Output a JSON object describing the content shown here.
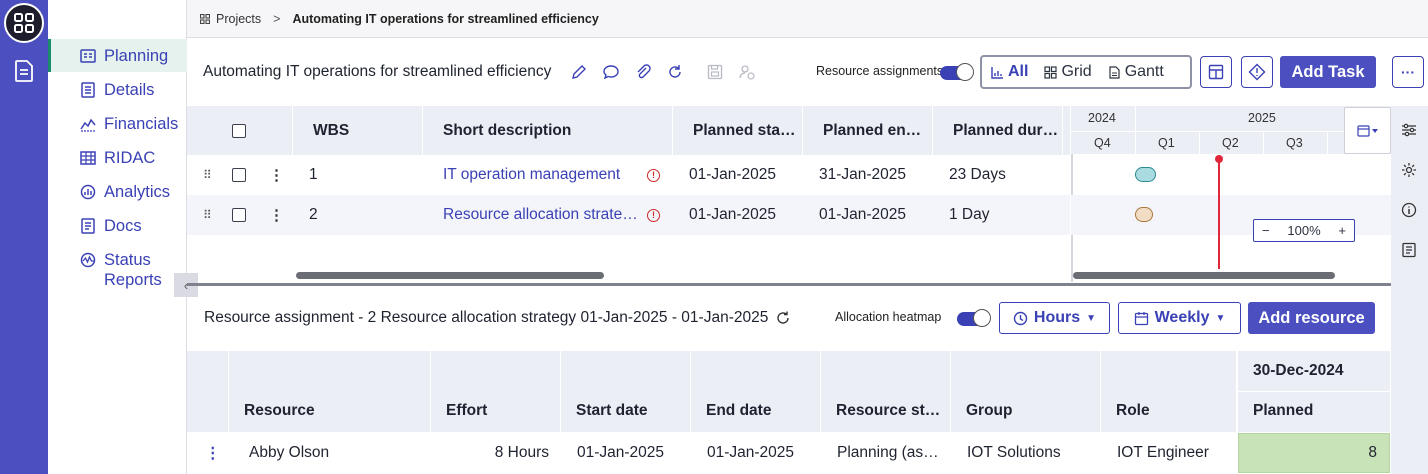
{
  "breadcrumb": {
    "root": "Projects",
    "separator": ">",
    "current": "Automating IT operations for streamlined efficiency"
  },
  "sidenav": {
    "items": [
      {
        "label": "Planning",
        "icon": "planning-icon"
      },
      {
        "label": "Details",
        "icon": "details-icon"
      },
      {
        "label": "Financials",
        "icon": "financials-icon"
      },
      {
        "label": "RIDAC",
        "icon": "ridac-icon"
      },
      {
        "label": "Analytics",
        "icon": "analytics-icon"
      },
      {
        "label": "Docs",
        "icon": "docs-icon"
      },
      {
        "label": "Status Reports",
        "label_line1": "Status",
        "label_line2": "Reports",
        "icon": "status-reports-icon"
      }
    ],
    "active": "Planning"
  },
  "toolbar": {
    "title": "Automating IT operations for streamlined efficiency",
    "resource_toggle_label": "Resource assignments",
    "resource_toggle_on": true,
    "views": [
      {
        "label": "All",
        "icon": "chart-icon",
        "active": true
      },
      {
        "label": "Grid",
        "icon": "grid-icon",
        "active": false
      },
      {
        "label": "Gantt",
        "icon": "document-icon",
        "active": false
      }
    ],
    "add_task_label": "Add Task",
    "more_label": "···"
  },
  "task_table": {
    "columns": [
      "WBS",
      "Short description",
      "Planned sta…",
      "Planned en…",
      "Planned dur…"
    ],
    "rows": [
      {
        "wbs": "1",
        "description": "IT operation management",
        "start": "01-Jan-2025",
        "end": "31-Jan-2025",
        "duration": "23 Days"
      },
      {
        "wbs": "2",
        "description": "Resource allocation strate…",
        "start": "01-Jan-2025",
        "end": "01-Jan-2025",
        "duration": "1 Day"
      }
    ]
  },
  "gantt": {
    "years": [
      "2024",
      "2025"
    ],
    "quarters": [
      "Q4",
      "Q1",
      "Q2",
      "Q3"
    ],
    "zoom": "100%",
    "zoom_minus": "−",
    "zoom_plus": "+",
    "bar_colors": [
      "#a9dbe1",
      "#f2dcc4"
    ],
    "today_color": "#e0263b"
  },
  "resource_panel": {
    "title": "Resource assignment - 2 Resource allocation strategy 01-Jan-2025 - 01-Jan-2025",
    "heatmap_label": "Allocation heatmap",
    "heatmap_on": true,
    "hours_label": "Hours",
    "weekly_label": "Weekly",
    "add_resource_label": "Add resource",
    "columns": [
      "Resource",
      "Effort",
      "Start date",
      "End date",
      "Resource st…",
      "Group",
      "Role"
    ],
    "period_header": "30-Dec-2024",
    "period_sub": "Planned",
    "rows": [
      {
        "resource": "Abby Olson",
        "effort": "8 Hours",
        "start": "01-Jan-2025",
        "end": "01-Jan-2025",
        "status": "Planning (as…",
        "group": "IOT Solutions",
        "role": "IOT Engineer",
        "planned": "8"
      }
    ]
  },
  "colors": {
    "accent": "#4b4fbf",
    "active_nav": "#1b8a6b",
    "heat_cell": "#c9e3b9"
  }
}
